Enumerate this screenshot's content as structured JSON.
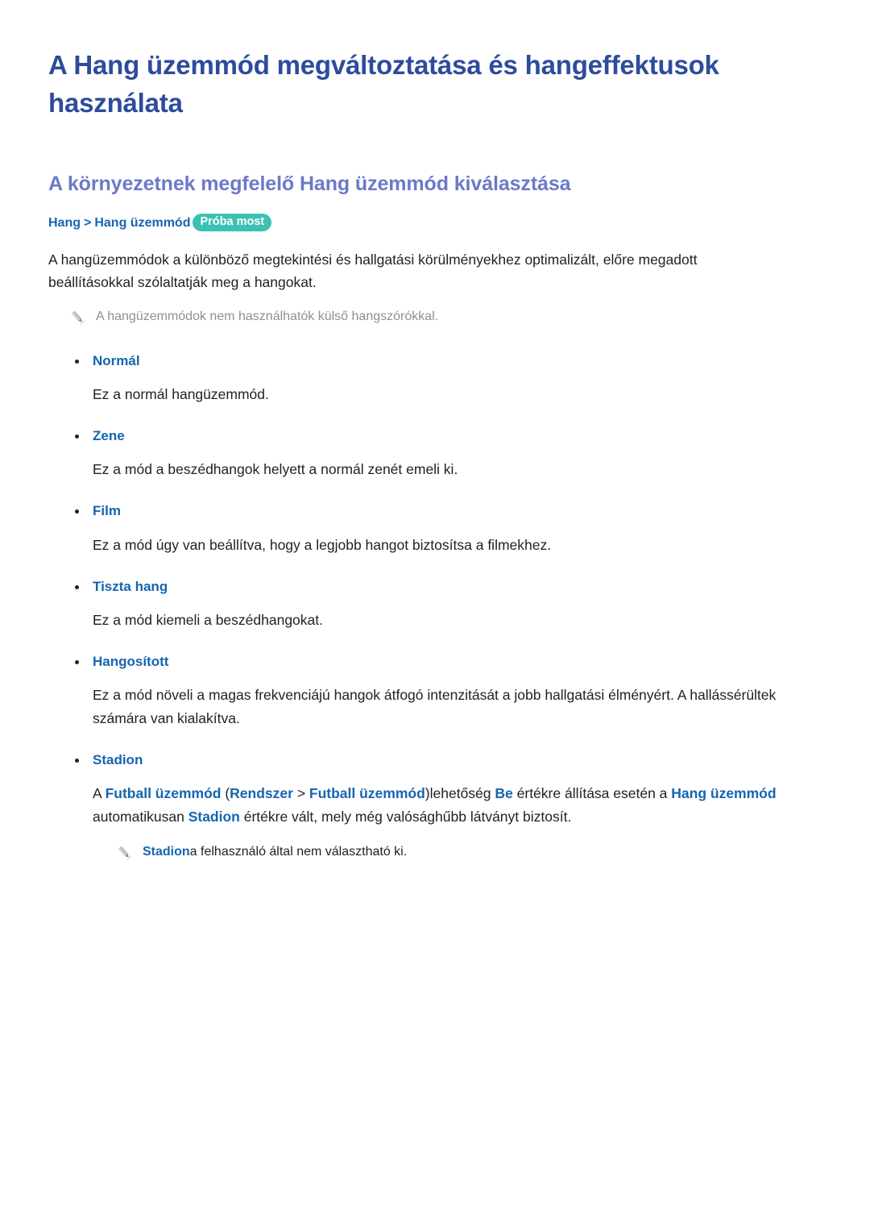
{
  "document": {
    "title": "A Hang üzemmód megváltoztatása és hangeffektusok használata",
    "section_heading": "A környezetnek megfelelő Hang üzemmód kiválasztása"
  },
  "breadcrumb": {
    "items": [
      "Hang",
      "Hang üzemmód"
    ],
    "separator": ">",
    "badge_label": "Próba most"
  },
  "intro": {
    "paragraph": "A hangüzemmódok a különböző megtekintési és hallgatási körülményekhez optimalizált, előre megadott beállításokkal szólaltatják meg a hangokat.",
    "note": "A hangüzemmódok nem használhatók külső hangszórókkal.",
    "note_icon": "pencil-icon"
  },
  "modes": [
    {
      "label": "Normál",
      "description": "Ez a normál hangüzemmód."
    },
    {
      "label": "Zene",
      "description": "Ez a mód a beszédhangok helyett a normál zenét emeli ki."
    },
    {
      "label": "Film",
      "description": "Ez a mód úgy van beállítva, hogy a legjobb hangot biztosítsa a filmekhez."
    },
    {
      "label": "Tiszta hang",
      "description": "Ez a mód kiemeli a beszédhangokat."
    },
    {
      "label": "Hangosított",
      "description": "Ez a mód növeli a magas frekvenciájú hangok átfogó intenzitását a jobb hallgatási élményért. A hallássérültek számára van kialakítva."
    },
    {
      "label": "Stadion",
      "rich_description": [
        {
          "text": "A ",
          "style": "plain"
        },
        {
          "text": "Futball üzemmód",
          "style": "link"
        },
        {
          "text": " (",
          "style": "plain"
        },
        {
          "text": "Rendszer",
          "style": "link"
        },
        {
          "text": " > ",
          "style": "plain"
        },
        {
          "text": "Futball üzemmód",
          "style": "link"
        },
        {
          "text": ")lehetőség ",
          "style": "plain"
        },
        {
          "text": "Be",
          "style": "link"
        },
        {
          "text": " értékre állítása esetén a ",
          "style": "plain"
        },
        {
          "text": "Hang üzemmód",
          "style": "link"
        },
        {
          "text": " automatikusan ",
          "style": "plain"
        },
        {
          "text": "Stadion",
          "style": "link"
        },
        {
          "text": " értékre vált, mely még valósághűbb látványt biztosít.",
          "style": "plain"
        }
      ],
      "note_rich": [
        {
          "text": "Stadion",
          "style": "link"
        },
        {
          "text": "a felhasználó által nem választható ki.",
          "style": "plain"
        }
      ],
      "note_icon": "pencil-icon"
    }
  ],
  "colors": {
    "title_blue": "#2e4b9c",
    "heading_periwinkle": "#6b79c9",
    "link_blue": "#1565b0",
    "badge_teal": "#3cc0b4",
    "note_gray": "#8b9097",
    "body_black": "#231f20"
  }
}
